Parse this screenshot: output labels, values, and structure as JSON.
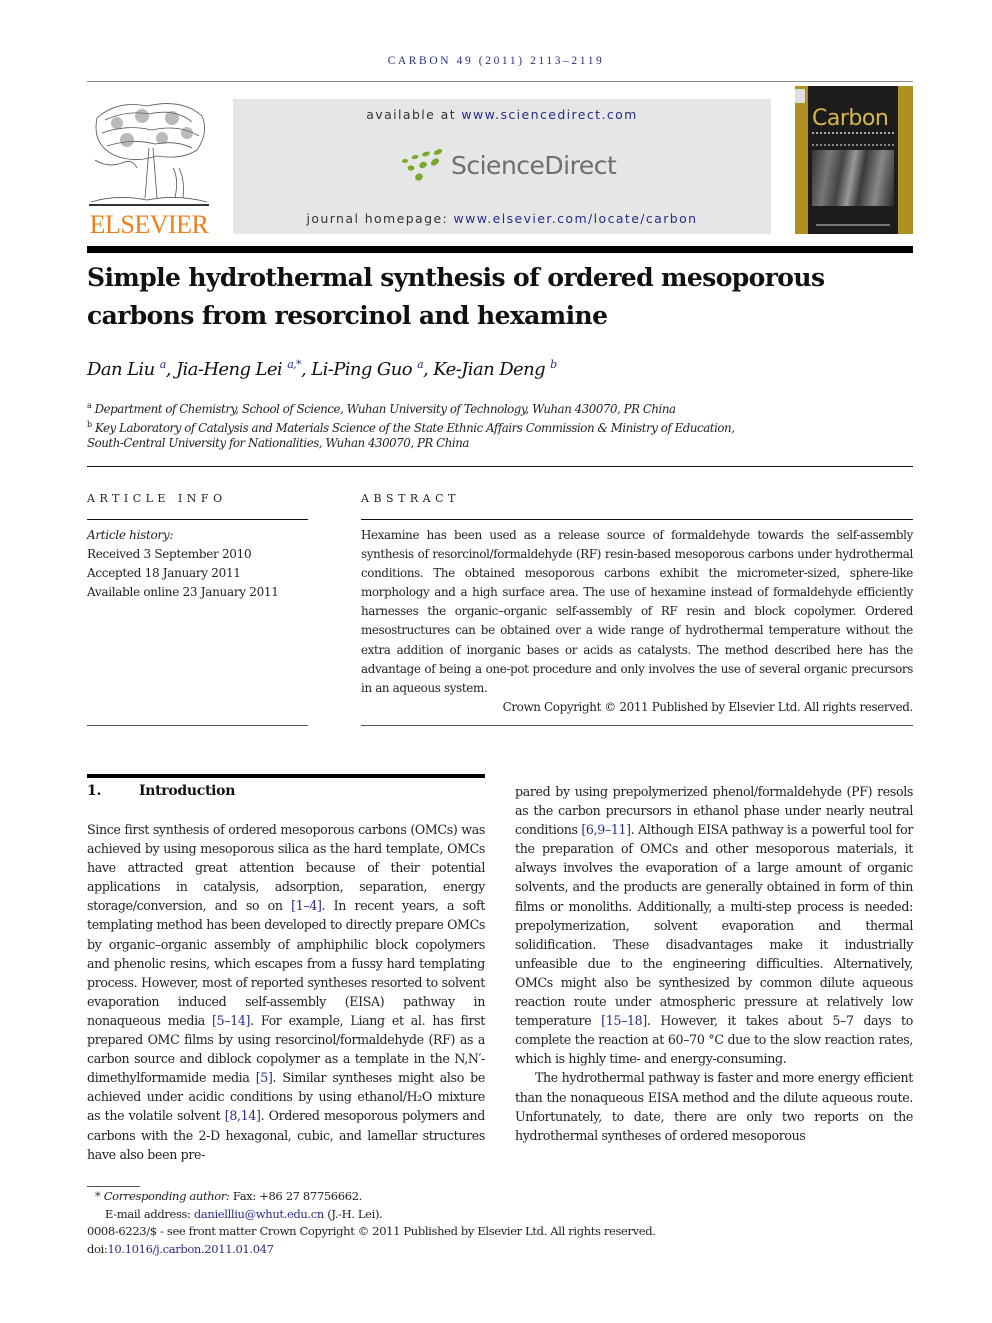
{
  "header": {
    "journal_citation": "CARBON 49 (2011) 2113–2119",
    "publisher_logo_word": "ELSEVIER",
    "sciencedirect": {
      "available_prefix": "available at ",
      "available_url": "www.sciencedirect.com",
      "logo_text": "ScienceDirect",
      "homepage_prefix": "journal homepage: ",
      "homepage_url": "www.elsevier.com/locate/carbon"
    },
    "cover": {
      "journal_name": "Carbon"
    },
    "colors": {
      "elsevier_orange": "#f07f1a",
      "sciencedirect_green": "#7aaa2a",
      "link_blue": "#2a2a8a",
      "cover_gold": "#b09020"
    }
  },
  "article": {
    "title_line1": "Simple hydrothermal synthesis of ordered mesoporous",
    "title_line2": "carbons from resorcinol and hexamine",
    "authors": [
      {
        "name": "Dan Liu",
        "sup": "a",
        "sep": ", "
      },
      {
        "name": "Jia-Heng Lei",
        "sup": "a,*",
        "sep": ", "
      },
      {
        "name": "Li-Ping Guo",
        "sup": "a",
        "sep": ", "
      },
      {
        "name": "Ke-Jian Deng",
        "sup": "b",
        "sep": ""
      }
    ],
    "affiliations": [
      {
        "sup": "a",
        "text": "Department of Chemistry, School of Science, Wuhan University of Technology, Wuhan 430070, PR China"
      },
      {
        "sup": "b",
        "text": "Key Laboratory of Catalysis and Materials Science of the State Ethnic Affairs Commission & Ministry of Education,"
      },
      {
        "sup": "",
        "text": "South-Central University for Nationalities, Wuhan 430070, PR China"
      }
    ]
  },
  "article_info": {
    "heading": "ARTICLE INFO",
    "history_label": "Article history:",
    "received": "Received 3 September 2010",
    "accepted": "Accepted 18 January 2011",
    "online": "Available online 23 January 2011"
  },
  "abstract": {
    "heading": "ABSTRACT",
    "text": "Hexamine has been used as a release source of formaldehyde towards the self-assembly synthesis of resorcinol/formaldehyde (RF) resin-based mesoporous carbons under hydrothermal conditions. The obtained mesoporous carbons exhibit the micrometer-sized, sphere-like morphology and a high surface area. The use of hexamine instead of formaldehyde efficiently harnesses the organic–organic self-assembly of RF resin and block copolymer. Ordered mesostructures can be obtained over a wide range of hydrothermal temperature without the extra addition of inorganic bases or acids as catalysts. The method described here has the advantage of being a one-pot procedure and only involves the use of several organic precursors in an aqueous system.",
    "copyright": "Crown Copyright © 2011 Published by Elsevier Ltd. All rights reserved."
  },
  "introduction": {
    "number": "1.",
    "heading": "Introduction",
    "left_p1_a": "Since first synthesis of ordered mesoporous carbons (OMCs) was achieved by using mesoporous silica as the hard template, OMCs have attracted great attention because of their potential applications in catalysis, adsorption, separation, energy storage/conversion, and so on ",
    "ref_1": "[1–4]",
    "left_p1_b": ". In recent years, a soft templating method has been developed to directly prepare OMCs by organic–organic assembly of amphiphilic block copolymers and phenolic resins, which escapes from a fussy hard templating process. However, most of reported syntheses resorted to solvent evaporation induced self-assembly (EISA) pathway in nonaqueous media ",
    "ref_2": "[5–14]",
    "left_p1_c": ". For example, Liang et al. has first prepared OMC films by using resorcinol/formaldehyde (RF) as a carbon source and diblock copolymer as a template in the N,N′-dimethylformamide media ",
    "ref_3": "[5]",
    "left_p1_d": ". Similar syntheses might also be achieved under acidic conditions by using ethanol/H₂O mixture as the volatile solvent ",
    "ref_4": "[8,14]",
    "left_p1_e": ". Ordered mesoporous polymers and carbons with the 2-D hexagonal, cubic, and lamellar structures have also been pre-",
    "right_p1_a": "pared by using prepolymerized phenol/formaldehyde (PF) resols as the carbon precursors in ethanol phase under nearly neutral conditions ",
    "ref_5": "[6,9–11]",
    "right_p1_b": ". Although EISA pathway is a powerful tool for the preparation of OMCs and other mesoporous materials, it always involves the evaporation of a large amount of organic solvents, and the products are generally obtained in form of thin films or monoliths. Additionally, a multi-step process is needed: prepolymerization, solvent evaporation and thermal solidification. These disadvantages make it industrially unfeasible due to the engineering difficulties. Alternatively, OMCs might also be synthesized by common dilute aqueous reaction route under atmospheric pressure at relatively low temperature ",
    "ref_6": "[15–18]",
    "right_p1_c": ". However, it takes about 5–7 days to complete the reaction at 60–70 °C due to the slow reaction rates, which is highly time- and energy-consuming.",
    "right_p2": "The hydrothermal pathway is faster and more energy efficient than the nonaqueous EISA method and the dilute aqueous route. Unfortunately, to date, there are only two reports on the hydrothermal syntheses of ordered mesoporous"
  },
  "footnotes": {
    "corr_star": "*",
    "corr_label": "Corresponding author:",
    "corr_fax": " Fax: +86 27 87756662.",
    "email_label": "E-mail address: ",
    "email": "daniellliu@whut.edu.cn",
    "email_suffix": " (J.-H. Lei).",
    "issn_line": "0008-6223/$ - see front matter  Crown Copyright © 2011 Published by Elsevier Ltd. All rights reserved.",
    "doi_prefix": "doi:",
    "doi": "10.1016/j.carbon.2011.01.047"
  }
}
